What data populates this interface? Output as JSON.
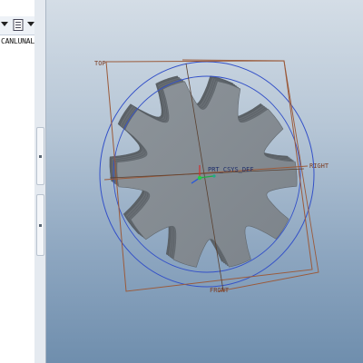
{
  "model_tree": {
    "partial_text": "CANLUNALV",
    "toolbar_icons": [
      "dropdown-arrow-icon",
      "tree-settings-icon",
      "dropdown-arrow-icon"
    ]
  },
  "viewport": {
    "datum_planes": {
      "top": "TOP",
      "right": "RIGHT",
      "front": "FRONT"
    },
    "coordinate_system_label": "PRT_CSYS_DEF"
  },
  "colors": {
    "gear_face": "#858c93",
    "gear_side": "#61676d",
    "datum_plane": "#9b5a3a",
    "datum_axis": "#2a3a7a",
    "reference_circle": "#3350c8"
  }
}
